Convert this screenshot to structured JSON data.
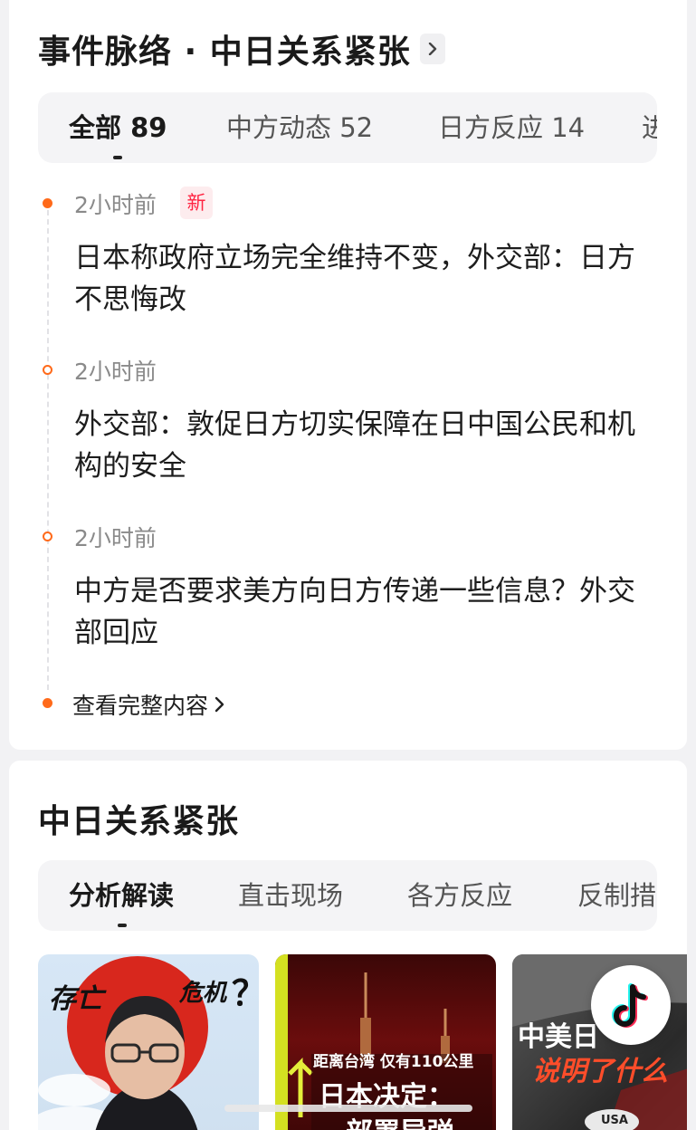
{
  "timeline_section": {
    "title": "事件脉络 · 中日关系紧张",
    "tabs": [
      {
        "label": "全部 89",
        "active": true
      },
      {
        "label": "中方动态 52",
        "active": false
      },
      {
        "label": "日方反应 14",
        "active": false
      },
      {
        "label": "进",
        "active": false
      }
    ],
    "items": [
      {
        "time": "2小时前",
        "badge": "新",
        "text": "日本称政府立场完全维持不变，外交部：日方不思悔改"
      },
      {
        "time": "2小时前",
        "text": "外交部：敦促日方切实保障在日中国公民和机构的安全"
      },
      {
        "time": "2小时前",
        "text": "中方是否要求美方向日方传递一些信息？外交部回应"
      }
    ],
    "view_all_label": "查看完整内容"
  },
  "topic_section": {
    "title": "中日关系紧张",
    "tabs": [
      {
        "label": "分析解读",
        "active": true
      },
      {
        "label": "直击现场",
        "active": false
      },
      {
        "label": "各方反应",
        "active": false
      },
      {
        "label": "反制措",
        "active": false
      }
    ],
    "videos": [
      {
        "overlay": [
          "存亡",
          "危机",
          "？"
        ]
      },
      {
        "overlay": [
          "距离台湾 仅有110公里",
          "日本决定：",
          "部署导弹"
        ]
      },
      {
        "overlay": [
          "中美日",
          "说明了什么",
          "USA"
        ]
      }
    ]
  },
  "colors": {
    "accent_orange": "#ff6a1a",
    "new_badge_red": "#ff2442",
    "page_bg": "#f2f2f4"
  },
  "icons": [
    "chevron-right-icon",
    "tiktok-logo-icon"
  ]
}
